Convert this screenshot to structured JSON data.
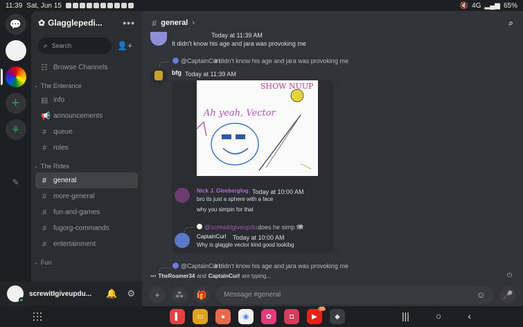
{
  "status_bar": {
    "time": "11:39",
    "date": "Sat, Jun 15",
    "network": "4G",
    "battery": "65%"
  },
  "guild": {
    "name": "Glagglepedi..."
  },
  "sidebar": {
    "search_placeholder": "Search",
    "browse_channels": "Browse Channels",
    "categories": [
      {
        "name": "The Enterance",
        "channels": [
          {
            "name": "info",
            "icon": "rules-icon"
          },
          {
            "name": "announcements",
            "icon": "megaphone-icon"
          },
          {
            "name": "queue",
            "icon": "hash-icon"
          },
          {
            "name": "roles",
            "icon": "hash-icon"
          }
        ]
      },
      {
        "name": "The Rides",
        "channels": [
          {
            "name": "general",
            "icon": "hash-icon",
            "active": true
          },
          {
            "name": "more-general",
            "icon": "hash-icon"
          },
          {
            "name": "fun-and-games",
            "icon": "hash-icon"
          },
          {
            "name": "fugorg-commands",
            "icon": "hash-icon"
          },
          {
            "name": "entertainment",
            "icon": "hash-icon"
          }
        ]
      },
      {
        "name": "Fun",
        "channels": []
      }
    ]
  },
  "user_panel": {
    "username": "screwitIgiveupdu..."
  },
  "chat": {
    "channel": "general",
    "messages": [
      {
        "time": "Today at 11:39 AM",
        "text": "It didn't know his age and jara was provoking me"
      },
      {
        "reply_author": "@CaptainCurl",
        "reply_text": "It didn't know his age and jara was provoking me",
        "author": "bfg",
        "time": "Today at 11:39 AM"
      }
    ],
    "embed": {
      "drawing_text_1": "Ah yeah, Vector",
      "drawing_text_2": "SHOW NUUP",
      "msg1_author": "Nick J. Gleeberglog",
      "msg1_time": "Today at 10:00 AM",
      "msg1_line1": "bro its just a sphere with a face",
      "msg1_line2": "why you simpin for that",
      "reply_author": "@screwitIgiveupdu...",
      "reply_text": "does he simp for",
      "msg2_author": "CaptainCurl",
      "msg2_time": "Today at 10:00 AM",
      "msg2_text": "Why is glaggle vector kind good lookibg"
    },
    "last_reply": {
      "author": "@CaptainCurl",
      "text": "It didn't know his age and jara was provoking me"
    },
    "typing": {
      "user1": "TheRoamer34",
      "connector": "and",
      "user2": "CaptainCurl",
      "suffix": "are typing..."
    },
    "composer_placeholder": "Message #general"
  },
  "dock": {
    "youtube_badge": "15"
  },
  "colors": {
    "accent": "#5865f2",
    "online": "#23a55a",
    "nick_purple": "#9b59b6"
  }
}
